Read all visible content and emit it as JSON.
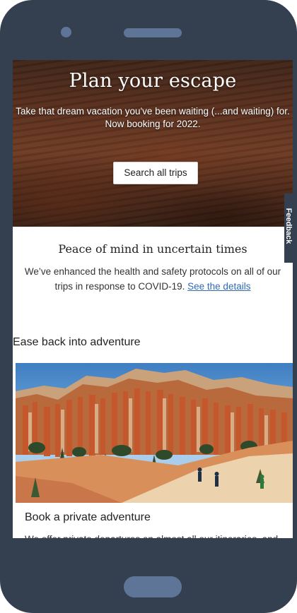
{
  "hero": {
    "title": "Plan your escape",
    "subtitle_line1": "Take that dream vacation you've been waiting (...and waiting) for.",
    "subtitle_line2": "Now booking for 2022.",
    "button_label": "Search all trips"
  },
  "feedback_tab": {
    "label": "Feedback"
  },
  "peace": {
    "title": "Peace of mind in uncertain times",
    "text": "We’ve enhanced the health and safety protocols on all of our trips in response to COVID-19.",
    "link_label": "See the details"
  },
  "section": {
    "heading": "Ease back into adventure"
  },
  "card": {
    "title": "Book a private adventure",
    "text": "We offer private departures on almost all our itineraries, and for groups of four or more they cost the same as our"
  },
  "colors": {
    "device_frame": "#343f4f",
    "device_accent": "#5f7598",
    "link": "#2f6ab5"
  }
}
